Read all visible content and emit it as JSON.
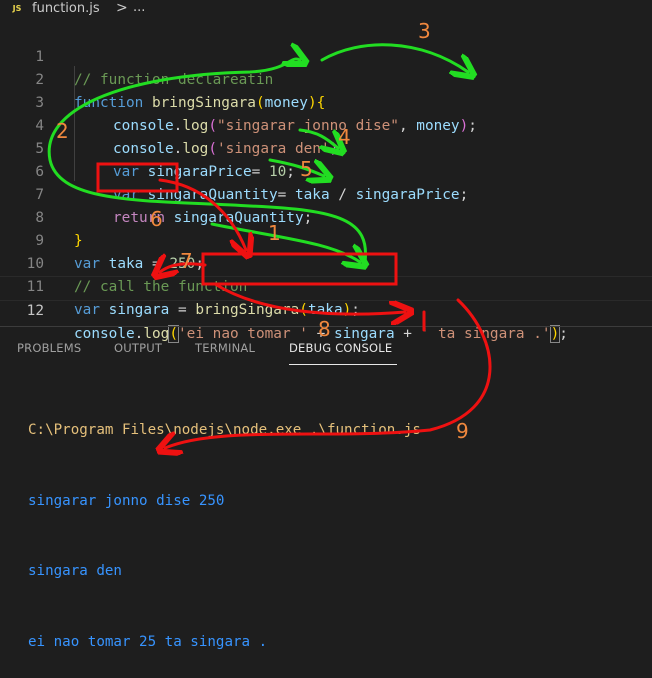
{
  "breadcrumb": {
    "badge": "JS",
    "file": "function.js",
    "separator": ">",
    "more": "..."
  },
  "editor": {
    "line_numbers": [
      "1",
      "2",
      "3",
      "4",
      "5",
      "6",
      "7",
      "8",
      "9",
      "10",
      "11",
      "12"
    ],
    "active_line": "12",
    "code": {
      "l1_comment": "// function declareatin",
      "l2_kw": "function",
      "l2_fn": "bringSingara",
      "l2_open": "(",
      "l2_param": "money",
      "l2_close": ")",
      "l2_brace": "{",
      "l3_obj": "console",
      "l3_dot": ".",
      "l3_method": "log",
      "l3_open": "(",
      "l3_str": "\"singarar jonno dise\"",
      "l3_comma": ", ",
      "l3_var": "money",
      "l3_close": ")",
      "l3_semi": ";",
      "l4_obj": "console",
      "l4_dot": ".",
      "l4_method": "log",
      "l4_open": "(",
      "l4_str": "'singara den'",
      "l4_close": ")",
      "l4_semi": ";",
      "l5_kw": "var",
      "l5_var": "singaraPrice",
      "l5_eq": "= ",
      "l5_num": "10",
      "l5_semi": ";",
      "l6_kw": "var",
      "l6_var": "singaraQuantity",
      "l6_eq": "= ",
      "l6_a": "taka",
      "l6_div": " / ",
      "l6_b": "singaraPrice",
      "l6_semi": ";",
      "l7_kw": "return",
      "l7_var": "singaraQuantity",
      "l7_semi": ";",
      "l8_brace": "}",
      "l9_kw": "var",
      "l9_var": "taka",
      "l9_eq": " = ",
      "l9_num": "250",
      "l9_semi": ";",
      "l10_comment": "// call the function",
      "l11_kw": "var",
      "l11_var": "singara",
      "l11_eq": " = ",
      "l11_fn": "bringSingara",
      "l11_open": "(",
      "l11_arg": "taka",
      "l11_close": ")",
      "l11_semi": ";",
      "l12_obj": "console",
      "l12_dot": ".",
      "l12_method": "log",
      "l12_open": "(",
      "l12_str1": "'ei nao tomar '",
      "l12_plus1": " + ",
      "l12_var": "singara",
      "l12_plus2": " + ",
      "l12_str2": "' ta singara .'",
      "l12_close": ")",
      "l12_semi": ";"
    }
  },
  "panel": {
    "tabs": [
      {
        "label": "PROBLEMS"
      },
      {
        "label": "OUTPUT"
      },
      {
        "label": "TERMINAL"
      },
      {
        "label": "DEBUG CONSOLE"
      }
    ],
    "active_tab": "DEBUG CONSOLE",
    "console_lines": [
      "C:\\Program Files\\nodejs\\node.exe .\\function.js",
      "singarar jonno dise 250",
      "singara den",
      "ei nao tomar 25 ta singara ."
    ]
  },
  "annotations": {
    "numbers": [
      "1",
      "2",
      "3",
      "4",
      "5",
      "6",
      "7",
      "8",
      "9"
    ],
    "colors": {
      "green": "#22dd22",
      "red": "#ee1111",
      "number": "#f0883e"
    }
  }
}
